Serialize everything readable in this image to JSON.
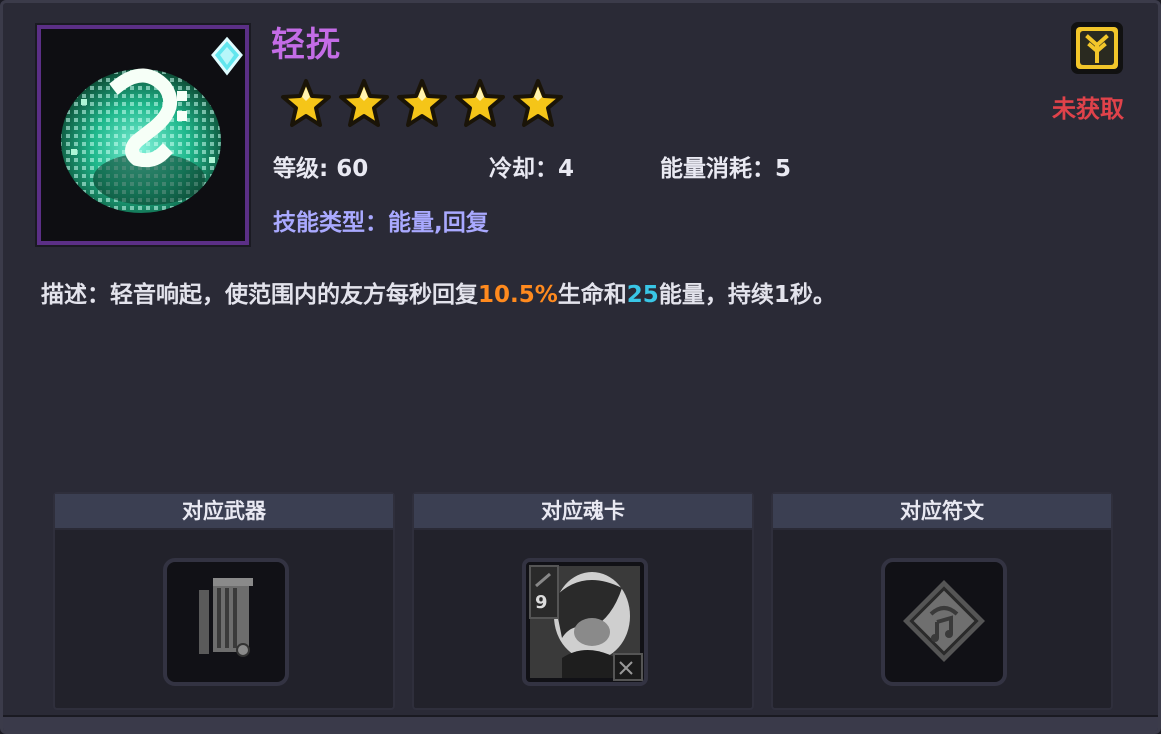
{
  "skill": {
    "name": "轻抚",
    "stars": 5,
    "level_label": "等级: 60",
    "cooldown_label": "冷却：4",
    "energy_label": "能量消耗：5",
    "type_prefix": "技能类型：",
    "type_value": "能量,回复",
    "status": "未获取",
    "description": {
      "prefix": "描述：轻音响起，使范围内的友方每秒回复",
      "heal_value": "10.5%",
      "mid": "生命和",
      "energy_value": "25",
      "suffix": "能量，持续1秒。"
    }
  },
  "cards": {
    "weapon_title": "对应武器",
    "soul_title": "对应魂卡",
    "rune_title": "对应符文",
    "soul_level": "9"
  },
  "colors": {
    "title": "#c46ce6",
    "status": "#e0424a",
    "heal_highlight": "#ff8a1e",
    "energy_highlight": "#39c6e6",
    "skill_type": "#a9a9ff",
    "star": "#f5c518",
    "frame": "#5b2f86"
  },
  "icons": {
    "skill": "green-music-note-orb-icon",
    "badge": "yellow-branch-badge-icon",
    "weapon": "lyre-weapon-icon",
    "soul": "character-portrait-card",
    "rune": "diamond-music-rune-icon"
  }
}
